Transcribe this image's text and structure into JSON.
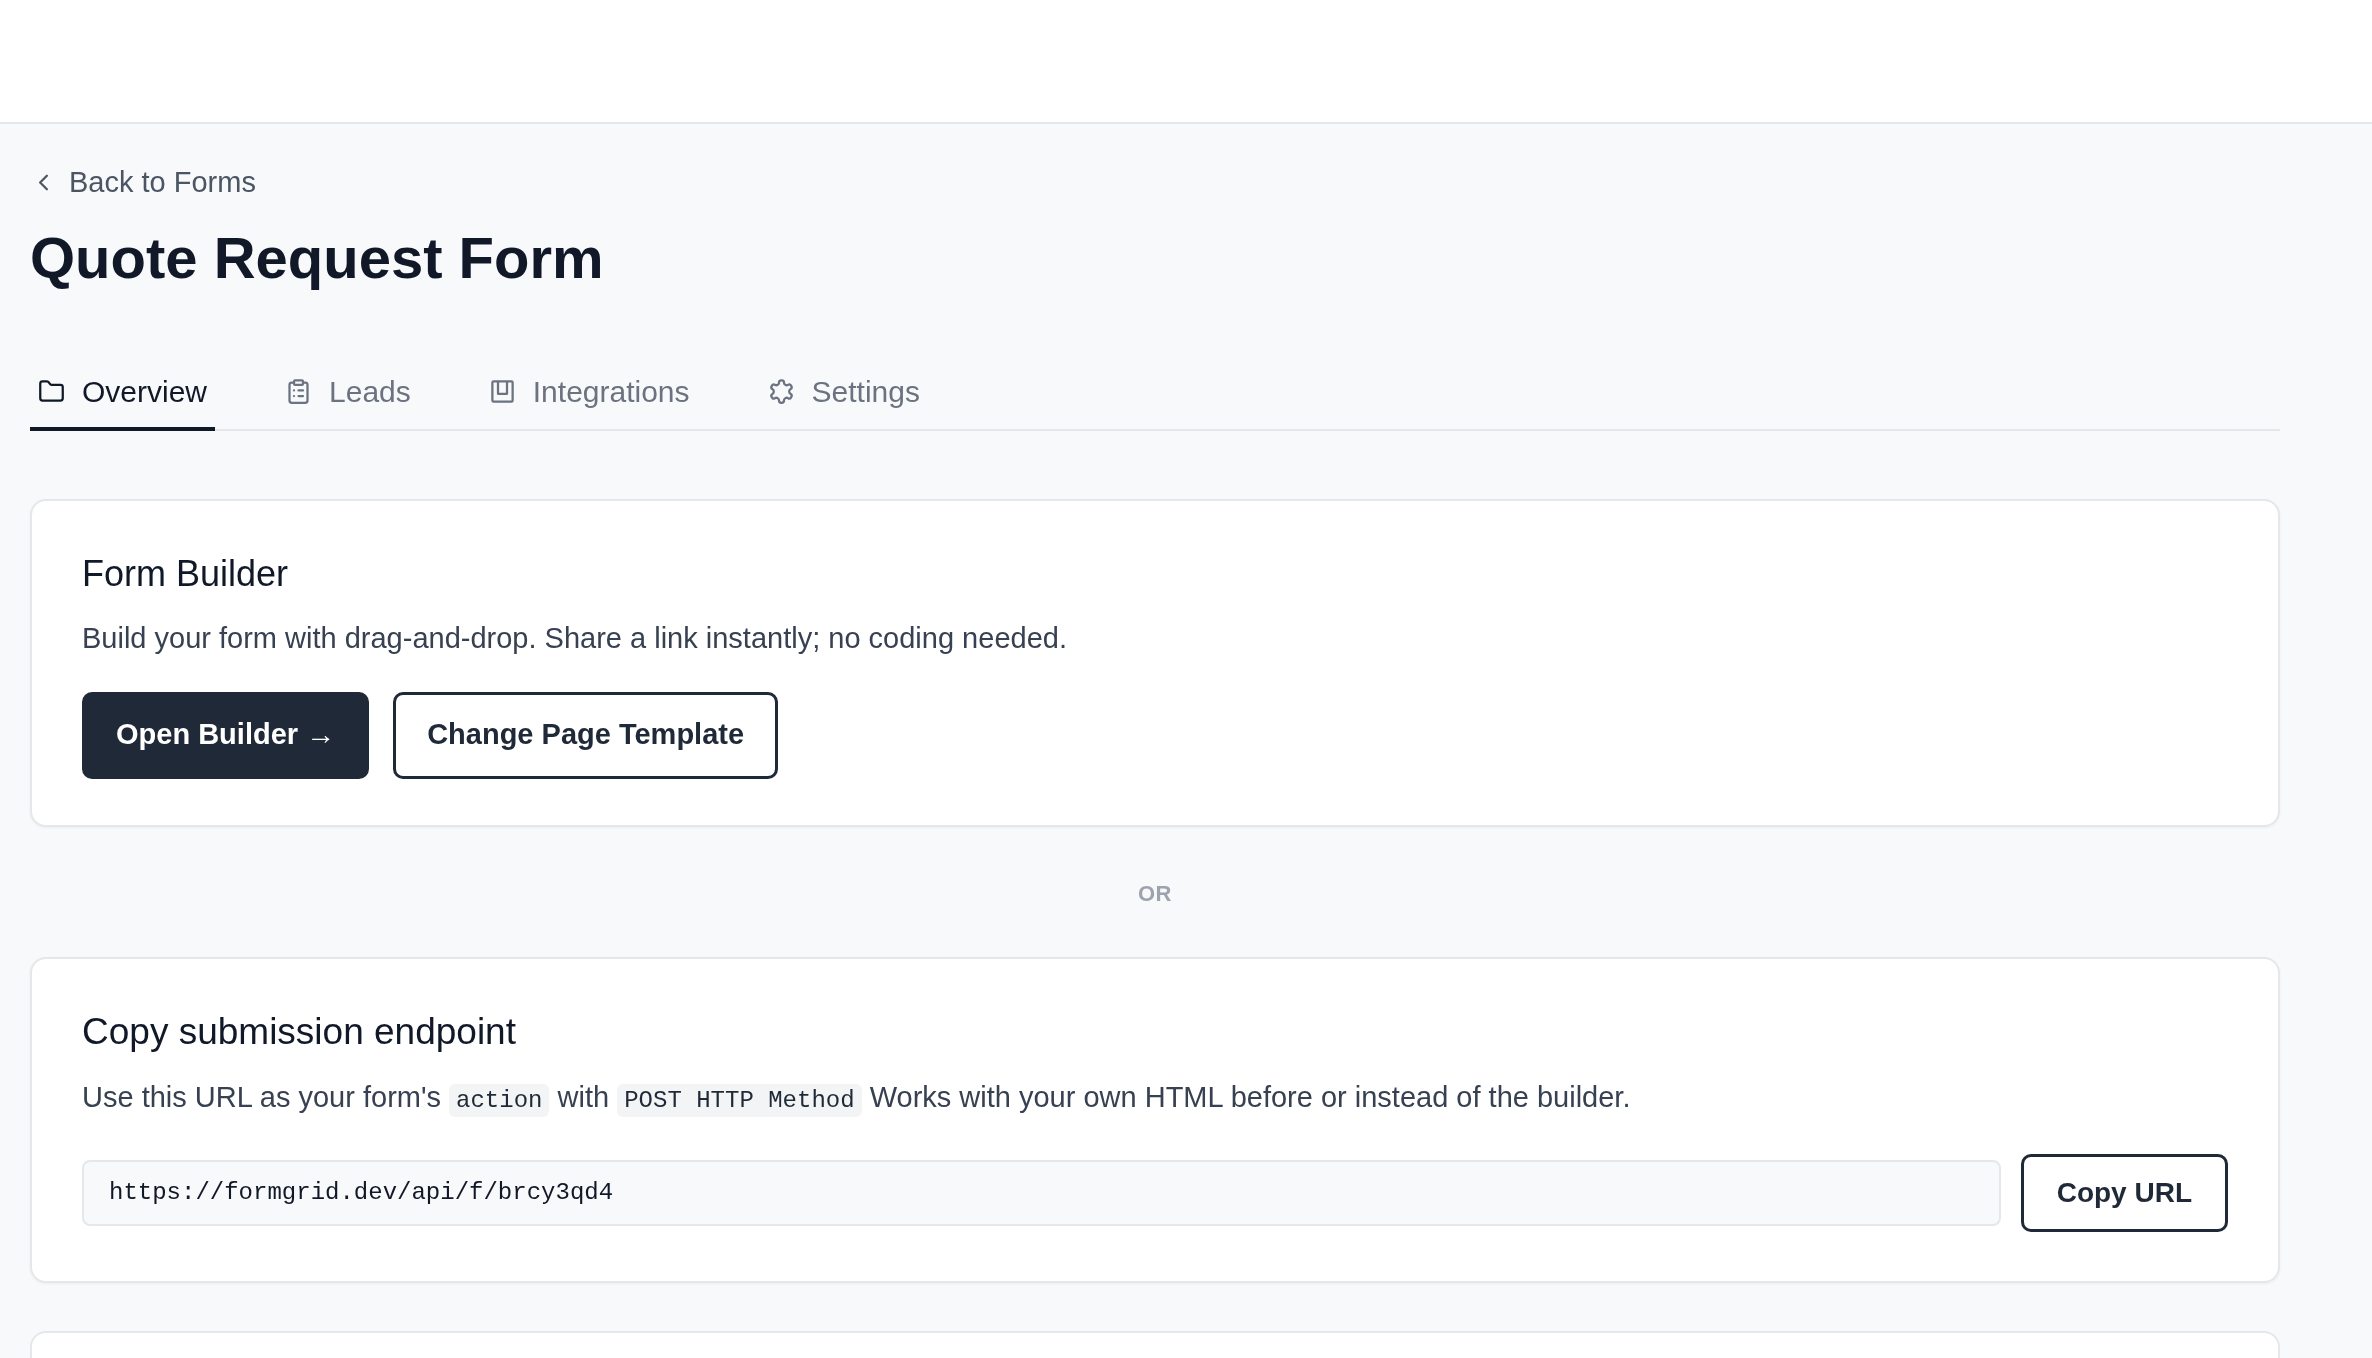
{
  "back_link": "Back to Forms",
  "title": "Quote Request Form",
  "tabs": [
    {
      "label": "Overview",
      "selected": true
    },
    {
      "label": "Leads",
      "selected": false
    },
    {
      "label": "Integrations",
      "selected": false
    },
    {
      "label": "Settings",
      "selected": false
    }
  ],
  "form_builder": {
    "title": "Form Builder",
    "description": "Build your form with drag-and-drop. Share a link instantly; no coding needed.",
    "buttons": [
      {
        "kind": "primary",
        "label": "Open Builder →"
      },
      {
        "kind": "outline",
        "label": "Change Page Template"
      }
    ]
  },
  "separator": "OR",
  "endpoint": {
    "title": "Copy submission endpoint",
    "description": [
      {
        "kind": "text",
        "text": "Use this URL as your form's "
      },
      {
        "kind": "code",
        "text": "action"
      },
      {
        "kind": "text",
        "text": " with "
      },
      {
        "kind": "code",
        "text": "POST HTTP Method"
      },
      {
        "kind": "text",
        "text": " Works with your own HTML before or instead of the builder."
      }
    ],
    "url_field": {
      "value": "https://formgrid.dev/api/f/brcy3qd4"
    },
    "copy_button": "Copy URL"
  }
}
